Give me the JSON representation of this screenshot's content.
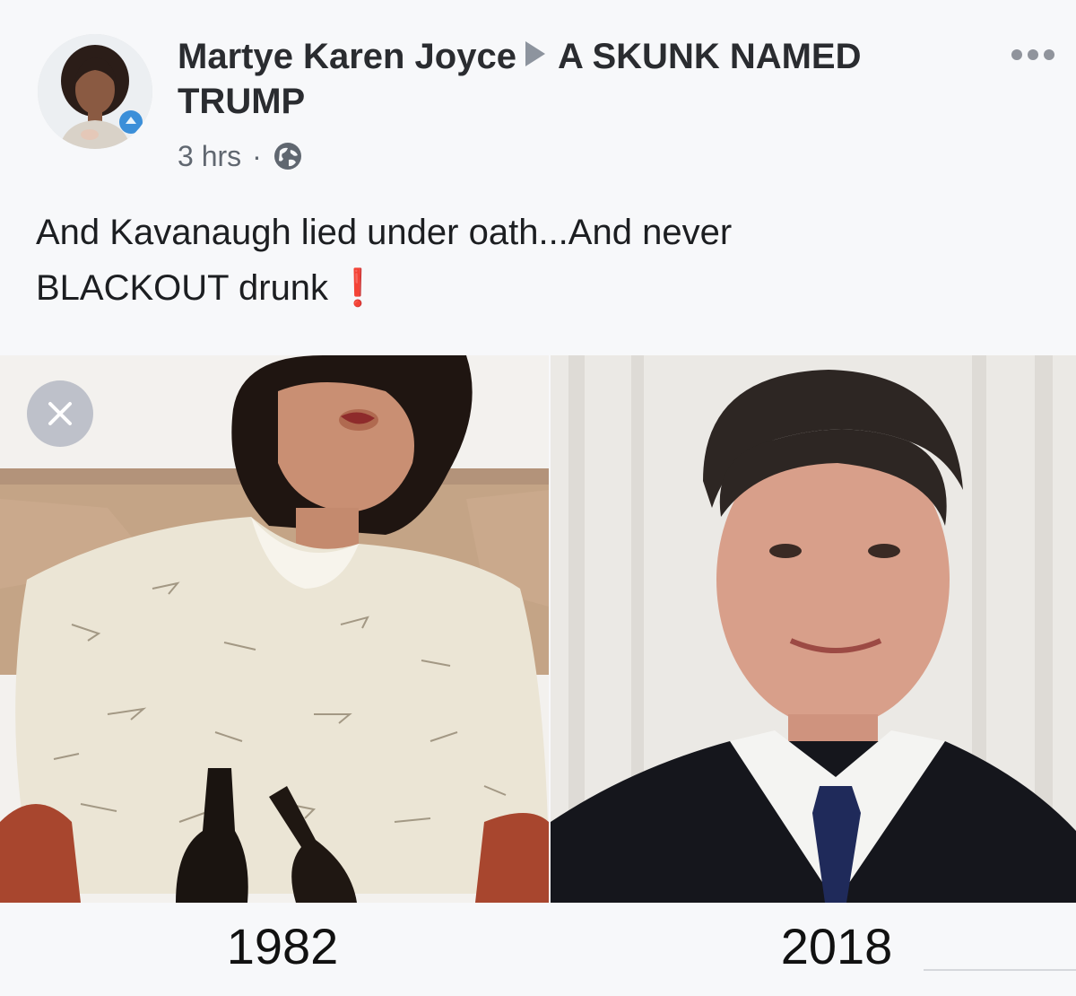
{
  "post": {
    "author": "Martye Karen Joyce",
    "group": "A SKUNK NAMED TRUMP",
    "time": "3 hrs",
    "separator": "·",
    "caption_line1": "And Kavanaugh lied under oath...And never",
    "caption_line2": "BLACKOUT drunk",
    "caption_emoji": "❗",
    "icons": {
      "more": "more-options-icon",
      "privacy": "globe-icon",
      "close": "close-icon"
    },
    "images": {
      "left_year": "1982",
      "right_year": "2018"
    }
  },
  "colors": {
    "background": "#f7f8fa",
    "meta_text": "#606770",
    "exclamation": "#e02020"
  }
}
